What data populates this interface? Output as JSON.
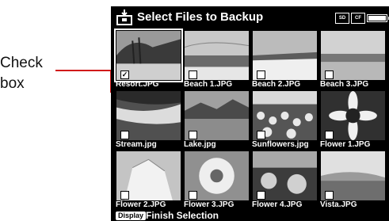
{
  "callout": {
    "line1": "Check",
    "line2": "box"
  },
  "header": {
    "title": "Select Files to Backup",
    "icon": "backup-icon",
    "status": {
      "badge1": "SD",
      "badge2": "CF"
    }
  },
  "files": [
    {
      "name": "Resort.JPG",
      "checked": true,
      "check_mark": "✓"
    },
    {
      "name": "Beach 1.JPG",
      "checked": false,
      "check_mark": ""
    },
    {
      "name": "Beach 2.JPG",
      "checked": false,
      "check_mark": ""
    },
    {
      "name": "Beach 3.JPG",
      "checked": false,
      "check_mark": ""
    },
    {
      "name": "Stream.jpg",
      "checked": false,
      "check_mark": ""
    },
    {
      "name": "Lake.jpg",
      "checked": false,
      "check_mark": ""
    },
    {
      "name": "Sunflowers.jpg",
      "checked": false,
      "check_mark": ""
    },
    {
      "name": "Flower 1.JPG",
      "checked": false,
      "check_mark": ""
    },
    {
      "name": "Flower 2.JPG",
      "checked": false,
      "check_mark": ""
    },
    {
      "name": "Flower 3.JPG",
      "checked": false,
      "check_mark": ""
    },
    {
      "name": "Flower 4.JPG",
      "checked": false,
      "check_mark": ""
    },
    {
      "name": "Vista.JPG",
      "checked": false,
      "check_mark": ""
    }
  ],
  "footer": {
    "key": "Display",
    "label": "Finish Selection"
  },
  "colors": {
    "background": "#000000",
    "text": "#ffffff",
    "callout_line": "#d11a1a"
  }
}
